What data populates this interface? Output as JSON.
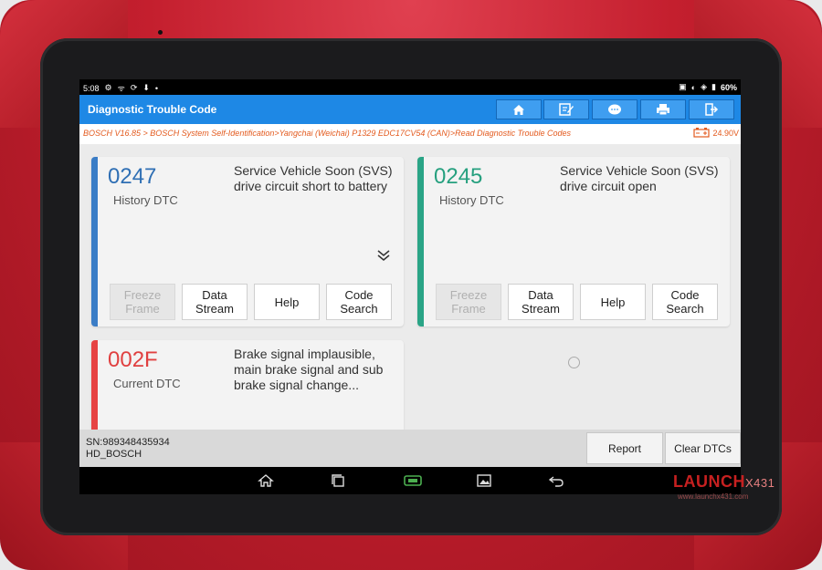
{
  "status_bar": {
    "time": "5:08",
    "battery": "60%"
  },
  "titlebar": {
    "title": "Diagnostic Trouble Code",
    "buttons": [
      "home-icon",
      "report-edit-icon",
      "chat-icon",
      "print-icon",
      "exit-icon"
    ]
  },
  "breadcrumb": {
    "path": "BOSCH V16.85 > BOSCH System Self-Identification>Yangchai (Weichai) P1329 EDC17CV54 (CAN)>Read Diagnostic Trouble Codes",
    "voltage": "24.90V"
  },
  "dtcs": [
    {
      "code": "0247",
      "type": "History DTC",
      "description": "Service Vehicle Soon (SVS) drive circuit short to battery",
      "accent": "#3b7dc6",
      "code_color": "#2f6fb4",
      "buttons": {
        "freeze_frame": "Freeze Frame",
        "data_stream": "Data Stream",
        "help": "Help",
        "code_search": "Code Search"
      }
    },
    {
      "code": "0245",
      "type": "History DTC",
      "description": "Service Vehicle Soon (SVS) drive circuit open",
      "accent": "#2aa486",
      "code_color": "#26a07f",
      "buttons": {
        "freeze_frame": "Freeze Frame",
        "data_stream": "Data Stream",
        "help": "Help",
        "code_search": "Code Search"
      }
    },
    {
      "code": "002F",
      "type": "Current DTC",
      "description": "Brake signal implausible, main brake signal and sub brake signal change...",
      "accent": "#e64343",
      "code_color": "#e04040"
    }
  ],
  "bottom": {
    "serial": "SN:989348435934",
    "module": "HD_BOSCH",
    "report_label": "Report",
    "clear_label": "Clear DTCs"
  },
  "nav_icons": [
    "home-icon",
    "recent-apps-icon",
    "vci-icon",
    "screenshot-icon",
    "back-icon"
  ],
  "watermark": {
    "brand": "LAUNCH",
    "suffix": "X431",
    "url": "www.launchx431.com"
  },
  "colors": {
    "titlebar": "#1e88e5",
    "bezel_red": "#c41f2e",
    "breadcrumb_text": "#e35a1e"
  }
}
